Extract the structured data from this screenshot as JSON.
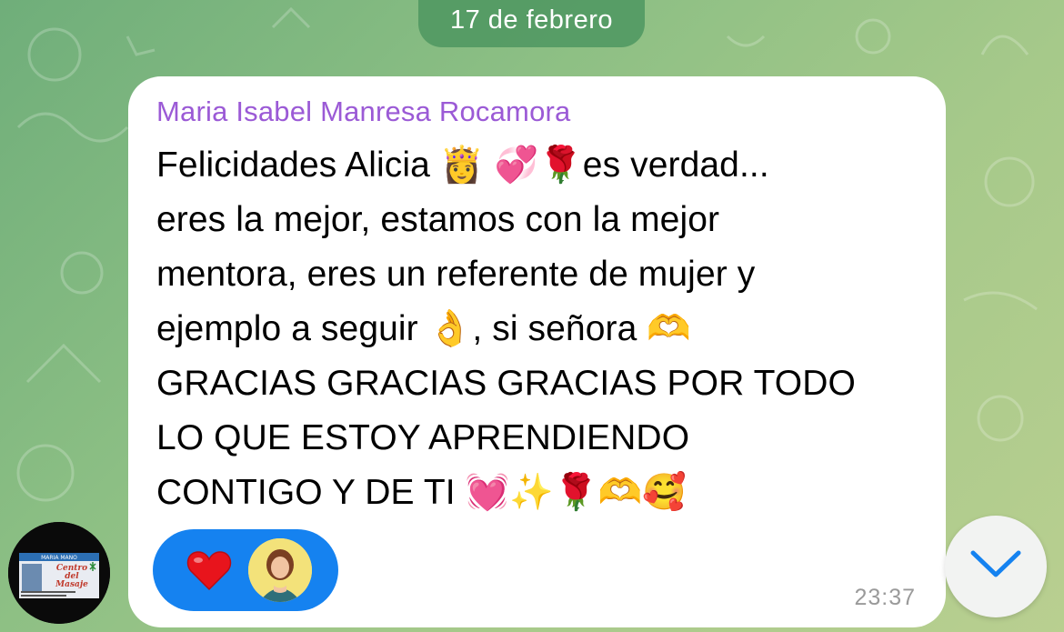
{
  "chat": {
    "date_separator": "17 de febrero",
    "message": {
      "sender": "Maria Isabel Manresa Rocamora",
      "lines": [
        "Felicidades Alicia 👸  💞🌹es verdad...",
        "eres la mejor, estamos con la mejor",
        "mentora, eres un referente de mujer y",
        "ejemplo a seguir 👌, si señora 🫶",
        "GRACIAS GRACIAS GRACIAS POR TODO",
        "LO QUE ESTOY APRENDIENDO",
        "CONTIGO Y DE TI 💓✨🌹🫶🥰"
      ],
      "time": "23:37",
      "reaction": {
        "emoji": "heart",
        "icon": "red-heart-icon"
      }
    },
    "sender_avatar_text": {
      "line1": "MARIA MANO",
      "line2": "Centro",
      "line3": "del",
      "line4": "Masaje"
    },
    "scroll_button_icon": "chevron-down-icon"
  }
}
